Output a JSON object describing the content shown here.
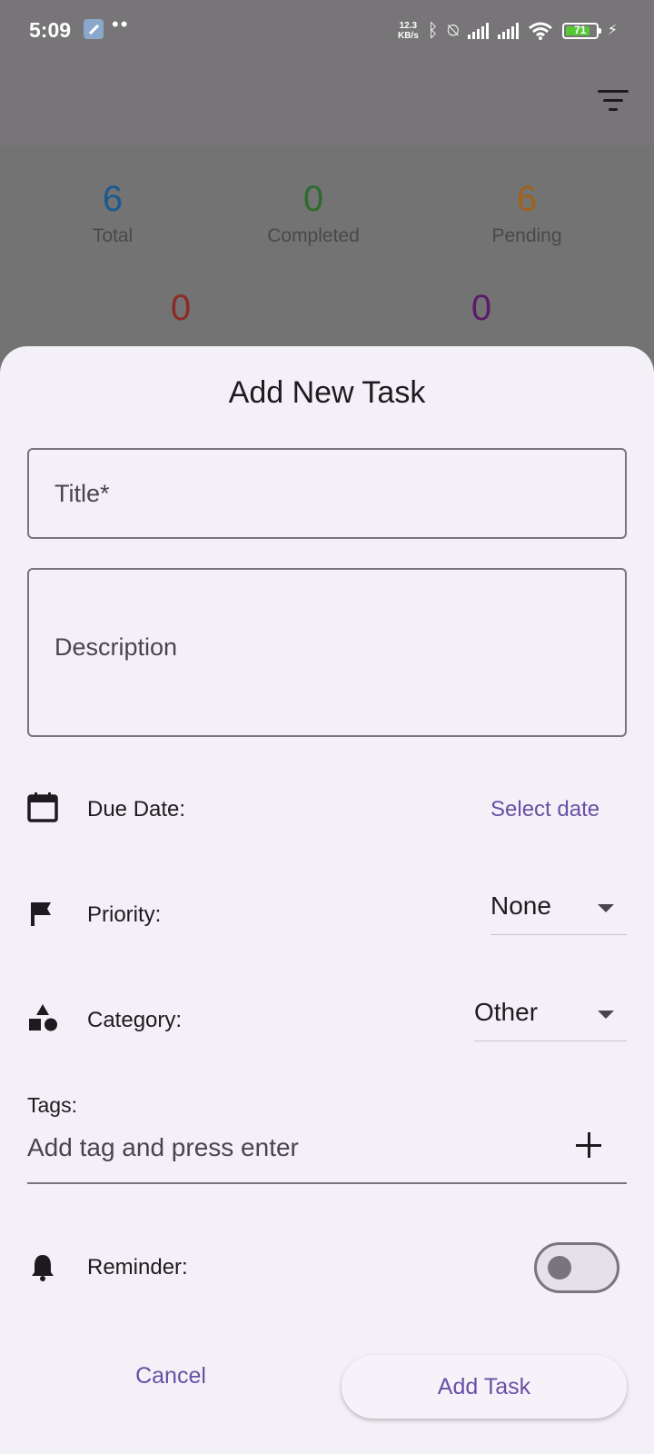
{
  "status_bar": {
    "time": "5:09",
    "speed_value": "12.3",
    "speed_unit": "KB/s",
    "battery": "71"
  },
  "stats": {
    "total": {
      "value": "6",
      "label": "Total",
      "color": "#1b5a8f"
    },
    "completed": {
      "value": "0",
      "label": "Completed",
      "color": "#2e6b2e"
    },
    "pending": {
      "value": "6",
      "label": "Pending",
      "color": "#a0621a"
    },
    "fourth": {
      "value": "0",
      "color": "#8c2b25"
    },
    "fifth": {
      "value": "0",
      "color": "#5b1a6b"
    }
  },
  "sheet": {
    "title": "Add New Task",
    "title_field": {
      "placeholder": "Title*",
      "value": ""
    },
    "description_field": {
      "placeholder": "Description",
      "value": ""
    },
    "due_date": {
      "label": "Due Date:",
      "action": "Select date"
    },
    "priority": {
      "label": "Priority:",
      "value": "None"
    },
    "category": {
      "label": "Category:",
      "value": "Other"
    },
    "tags": {
      "label": "Tags:",
      "placeholder": "Add tag and press enter"
    },
    "reminder": {
      "label": "Reminder:",
      "enabled": false
    },
    "cancel_label": "Cancel",
    "add_label": "Add Task"
  },
  "colors": {
    "accent": "#6750a4",
    "sheet_bg": "#f4f0f7",
    "scrim": "#737373"
  }
}
